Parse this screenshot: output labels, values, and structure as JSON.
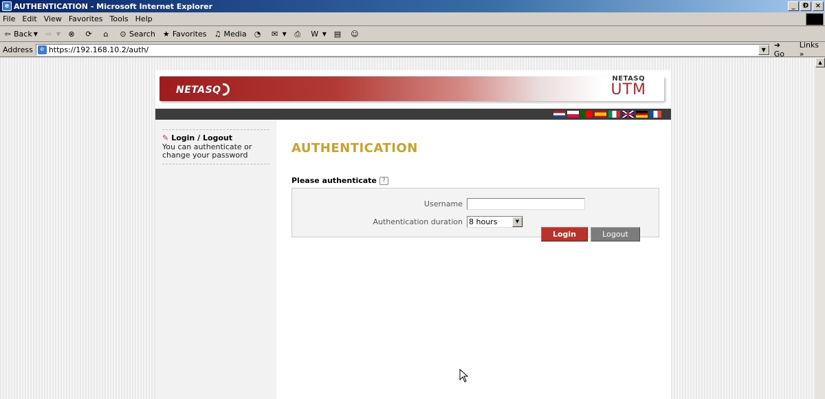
{
  "window": {
    "title": "AUTHENTICATION - Microsoft Internet Explorer",
    "controls": [
      "_",
      "Ɖ",
      "×"
    ]
  },
  "menu": [
    "File",
    "Edit",
    "View",
    "Favorites",
    "Tools",
    "Help"
  ],
  "toolbar": {
    "back": "Back",
    "search": "Search",
    "favorites": "Favorites",
    "media": "Media"
  },
  "address": {
    "label": "Address",
    "url": "https://192.168.10.2/auth/",
    "go": "Go",
    "links": "Links »"
  },
  "header": {
    "logo": "NETASQ",
    "product_brand": "NETASQ",
    "product": "UTM"
  },
  "flags": [
    {
      "name": "dutch",
      "colors": [
        "#ae1c28",
        "#ffffff",
        "#21468b"
      ]
    },
    {
      "name": "polish",
      "colors": [
        "#ffffff",
        "#dc143c"
      ]
    },
    {
      "name": "portuguese",
      "colors": [
        "#006600",
        "#ff0000"
      ]
    },
    {
      "name": "spanish",
      "colors": [
        "#c60b1e",
        "#ffc400",
        "#c60b1e"
      ]
    },
    {
      "name": "italian",
      "colors": [
        "#009246",
        "#ffffff",
        "#ce2b37"
      ]
    },
    {
      "name": "uk",
      "colors": [
        "#012169",
        "#ffffff",
        "#c8102e"
      ]
    },
    {
      "name": "german",
      "colors": [
        "#000000",
        "#dd0000",
        "#ffce00"
      ]
    },
    {
      "name": "french",
      "colors": [
        "#0055a4",
        "#ffffff",
        "#ef4135"
      ]
    }
  ],
  "sidebar": {
    "title": "Login / Logout",
    "description": "You can authenticate or change your password"
  },
  "main": {
    "heading": "AUTHENTICATION",
    "subheading": "Please authenticate",
    "help": "?",
    "form": {
      "username_label": "Username",
      "username_value": "",
      "duration_label": "Authentication duration",
      "duration_value": "8 hours"
    },
    "login_button": "Login",
    "logout_button": "Logout"
  },
  "colors": {
    "heading": "#c8a22a",
    "login_button": "#b8332a",
    "logout_button": "#7c7c7c",
    "banner_red": "#9e1c1c"
  }
}
